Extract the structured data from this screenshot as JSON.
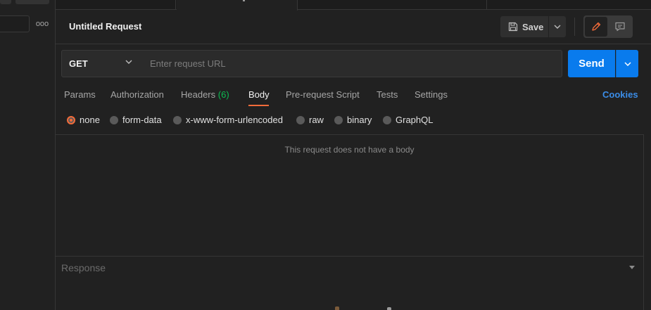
{
  "sidebar": {
    "more_label": "ooo"
  },
  "request": {
    "title": "Untitled Request",
    "save_label": "Save",
    "method": "GET",
    "url_placeholder": "Enter request URL",
    "send_label": "Send"
  },
  "tabs": {
    "items": [
      {
        "label": "Params"
      },
      {
        "label": "Authorization"
      },
      {
        "label": "Headers",
        "count": "(6)"
      },
      {
        "label": "Body"
      },
      {
        "label": "Pre-request Script"
      },
      {
        "label": "Tests"
      },
      {
        "label": "Settings"
      }
    ],
    "active": "Body",
    "cookies_label": "Cookies"
  },
  "body_types": {
    "items": [
      {
        "label": "none"
      },
      {
        "label": "form-data"
      },
      {
        "label": "x-www-form-urlencoded"
      },
      {
        "label": "raw"
      },
      {
        "label": "binary"
      },
      {
        "label": "GraphQL"
      }
    ],
    "selected": "none",
    "empty_message": "This request does not have a body"
  },
  "response": {
    "title": "Response"
  },
  "colors": {
    "accent": "#f26b3a",
    "send": "#097bed",
    "headers_count": "#0cbb52",
    "cookies": "#3b8de8"
  },
  "icons": {
    "save": "floppy-disk-icon",
    "edit": "pencil-icon",
    "comment": "comment-icon",
    "dropdown": "chevron-down-icon"
  }
}
